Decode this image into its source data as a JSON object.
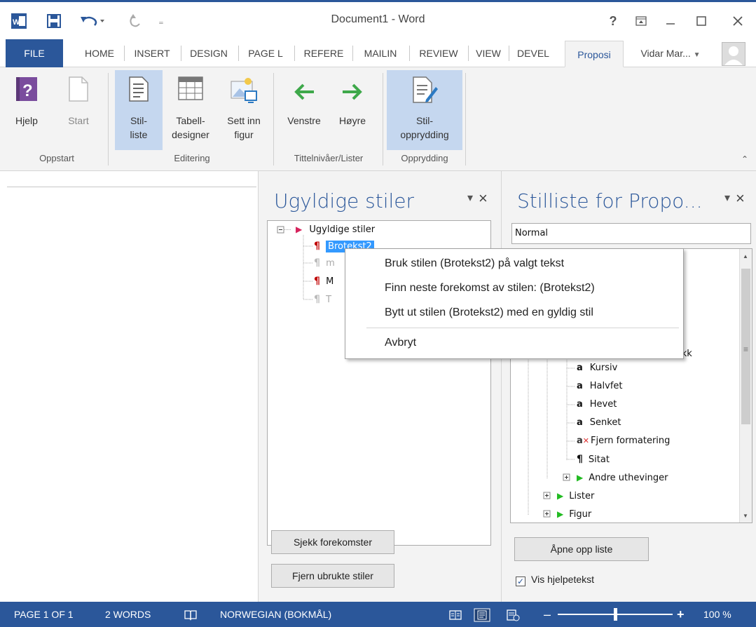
{
  "titlebar": {
    "title": "Document1 - Word",
    "help_label": "?"
  },
  "tabs": [
    {
      "label": "FILE"
    },
    {
      "label": "HOME"
    },
    {
      "label": "INSERT"
    },
    {
      "label": "DESIGN"
    },
    {
      "label": "PAGE L"
    },
    {
      "label": "REFERE"
    },
    {
      "label": "MAILIN"
    },
    {
      "label": "REVIEW"
    },
    {
      "label": "VIEW"
    },
    {
      "label": "DEVEL"
    },
    {
      "label": "Proposi"
    }
  ],
  "account": {
    "name": "Vidar Mar..."
  },
  "ribbon": {
    "buttons": {
      "hjelp": "Hjelp",
      "start": "Start",
      "stil_liste_1": "Stil-",
      "stil_liste_2": "liste",
      "tabell_1": "Tabell-",
      "tabell_2": "designer",
      "sett_1": "Sett inn",
      "sett_2": "figur",
      "venstre": "Venstre",
      "hoyre": "Høyre",
      "opp_1": "Stil-",
      "opp_2": "opprydding"
    },
    "groups": [
      "Oppstart",
      "Editering",
      "Tittelnivåer/Lister",
      "Opprydding"
    ]
  },
  "pane1": {
    "title": "Ugyldige stiler",
    "tree": {
      "root": "Ugyldige stiler",
      "items": [
        "Brotekst2",
        "m",
        "M",
        "T"
      ]
    },
    "buttons": {
      "check": "Sjekk forekomster",
      "remove": "Fjern ubrukte stiler"
    }
  },
  "pane2": {
    "title": "Stilliste for Propo...",
    "input_value": "Normal",
    "tree_items": [
      {
        "label": "ykk"
      },
      {
        "label": "Kursiv"
      },
      {
        "label": "Halvfet"
      },
      {
        "label": "Hevet"
      },
      {
        "label": "Senket"
      },
      {
        "label": "Fjern formatering"
      },
      {
        "label": "Sitat"
      },
      {
        "label": "Andre uthevinger"
      },
      {
        "label": "Lister"
      },
      {
        "label": "Figur"
      }
    ],
    "open_button": "Åpne opp liste",
    "checkbox_label": "Vis hjelpetekst",
    "checkbox_checked": true
  },
  "context_menu": {
    "items": [
      "Bruk stilen (Brotekst2) på valgt tekst",
      "Finn neste forekomst av stilen: (Brotekst2)",
      "Bytt ut stilen (Brotekst2) med en gyldig stil",
      "Avbryt"
    ]
  },
  "statusbar": {
    "page": "PAGE 1 OF 1",
    "words": "2 WORDS",
    "language": "NORWEGIAN (BOKMÅL)",
    "zoom": "100 %"
  },
  "colors": {
    "accent": "#2b579a",
    "selection": "#c5d7ef",
    "red_pilcrow": "#c00000",
    "green_arrow": "#3ea84a"
  }
}
